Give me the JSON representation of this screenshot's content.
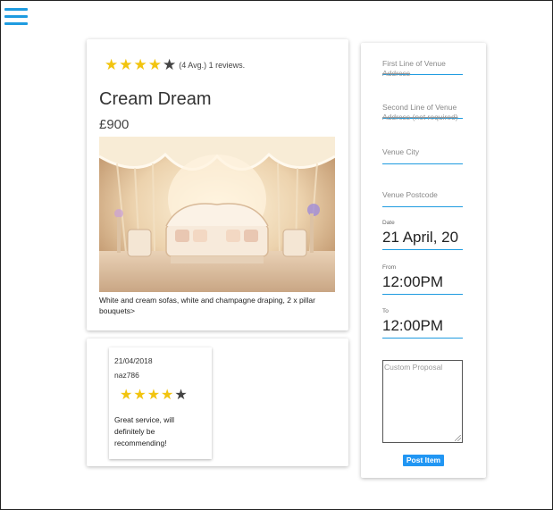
{
  "listing": {
    "stars": [
      "★",
      "★",
      "★",
      "★",
      "★"
    ],
    "rating_value": 4,
    "rating_text": "(4 Avg.) 1 reviews.",
    "title": "Cream Dream",
    "price": "£900",
    "description": "White and cream sofas, white and champagne draping, 2 x pillar bouquets>"
  },
  "review": {
    "date": "21/04/2018",
    "user": "naz786",
    "rating_value": 4,
    "text": "Great service, will definitely be recommending!"
  },
  "form": {
    "line1_label": "First Line of Venue",
    "line1_strike": "Address",
    "line2_label": "Second Line of Venue",
    "line2_strike": "Address (not required)",
    "city_label": "Venue City",
    "postcode_label": "Venue Postcode",
    "date_label": "Date",
    "date_value": "21 April, 20",
    "from_label": "From",
    "from_value": "12:00PM",
    "to_label": "To",
    "to_value": "12:00PM",
    "proposal_placeholder": "Custom Proposal",
    "post_button": "Post Item"
  },
  "icons": {
    "menu": "hamburger-menu-icon",
    "star": "star-icon"
  },
  "colors": {
    "accent": "#1e9be0",
    "star_on": "#f2c40f",
    "star_off": "#444444",
    "button": "#2196f3"
  }
}
